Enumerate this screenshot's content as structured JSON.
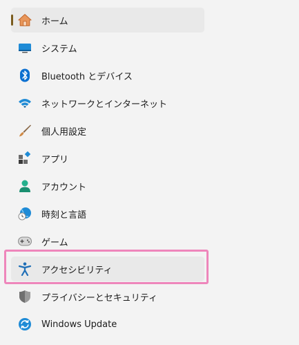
{
  "colors": {
    "accent_indicator": "#7a5c1e",
    "highlight_border": "#ee86bb",
    "selected_bg": "#e9e9e9"
  },
  "nav": {
    "items": [
      {
        "label": "ホーム",
        "icon": "home-icon"
      },
      {
        "label": "システム",
        "icon": "system-display-icon"
      },
      {
        "label": "Bluetooth とデバイス",
        "icon": "bluetooth-icon"
      },
      {
        "label": "ネットワークとインターネット",
        "icon": "wifi-icon"
      },
      {
        "label": "個人用設定",
        "icon": "paintbrush-icon"
      },
      {
        "label": "アプリ",
        "icon": "apps-icon"
      },
      {
        "label": "アカウント",
        "icon": "account-icon"
      },
      {
        "label": "時刻と言語",
        "icon": "time-language-icon"
      },
      {
        "label": "ゲーム",
        "icon": "gamepad-icon"
      },
      {
        "label": "アクセシビリティ",
        "icon": "accessibility-icon"
      },
      {
        "label": "プライバシーとセキュリティ",
        "icon": "shield-icon"
      },
      {
        "label": "Windows Update",
        "icon": "windows-update-icon"
      }
    ]
  }
}
